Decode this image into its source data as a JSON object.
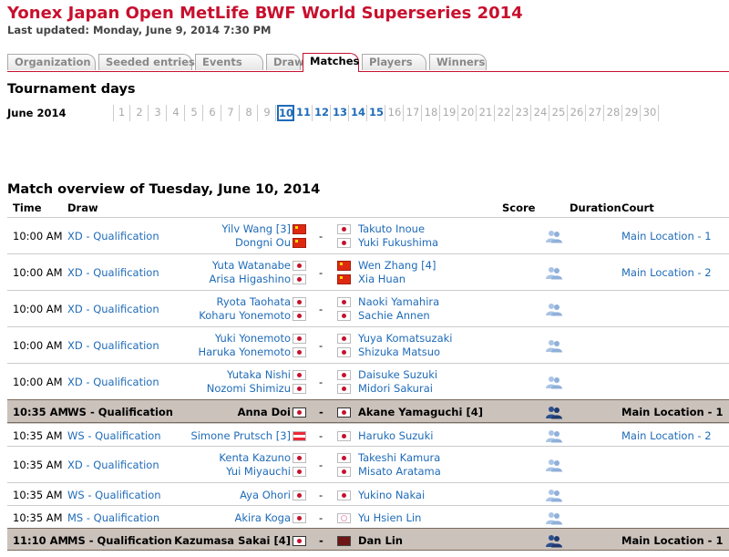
{
  "page": {
    "title": "Yonex Japan Open MetLife BWF World Superseries 2014",
    "last_updated": "Last updated: Monday, June 9, 2014 7:30 PM"
  },
  "tabs": [
    {
      "label": "Organization",
      "active": false
    },
    {
      "label": "Seeded entries",
      "active": false
    },
    {
      "label": "Events",
      "active": false
    },
    {
      "label": "Draws",
      "active": false
    },
    {
      "label": "Matches",
      "active": true
    },
    {
      "label": "Players",
      "active": false
    },
    {
      "label": "Winners",
      "active": false
    }
  ],
  "tournament_days": {
    "heading": "Tournament days",
    "month": "June 2014",
    "days": [
      "1",
      "2",
      "3",
      "4",
      "5",
      "6",
      "7",
      "8",
      "9",
      "10",
      "11",
      "12",
      "13",
      "14",
      "15",
      "16",
      "17",
      "18",
      "19",
      "20",
      "21",
      "22",
      "23",
      "24",
      "25",
      "26",
      "27",
      "28",
      "29",
      "30"
    ],
    "linked_days": [
      "10",
      "11",
      "12",
      "13",
      "14",
      "15"
    ],
    "selected_day": "10"
  },
  "overview": {
    "heading": "Match overview of Tuesday, June 10, 2014",
    "columns": {
      "time": "Time",
      "draw": "Draw",
      "score": "Score",
      "duration": "Duration",
      "court": "Court"
    }
  },
  "colors": {
    "brand": "#c8102e",
    "link": "#1f6bb8",
    "highlight_row": "#cbc2bb"
  },
  "matches": [
    {
      "time": "10:00 AM",
      "draw": "XD - Qualification",
      "left": [
        {
          "name": "Yilv Wang [3]",
          "flag": "cn"
        },
        {
          "name": "Dongni Ou",
          "flag": "cn"
        }
      ],
      "right": [
        {
          "name": "Takuto Inoue",
          "flag": "jp"
        },
        {
          "name": "Yuki Fukushima",
          "flag": "jp"
        }
      ],
      "court": "Main Location - 1",
      "highlight": false
    },
    {
      "time": "10:00 AM",
      "draw": "XD - Qualification",
      "left": [
        {
          "name": "Yuta Watanabe",
          "flag": "jp"
        },
        {
          "name": "Arisa Higashino",
          "flag": "jp"
        }
      ],
      "right": [
        {
          "name": "Wen Zhang [4]",
          "flag": "cn"
        },
        {
          "name": "Xia Huan",
          "flag": "cn"
        }
      ],
      "court": "Main Location - 2",
      "highlight": false
    },
    {
      "time": "10:00 AM",
      "draw": "XD - Qualification",
      "left": [
        {
          "name": "Ryota Taohata",
          "flag": "jp"
        },
        {
          "name": "Koharu Yonemoto",
          "flag": "jp"
        }
      ],
      "right": [
        {
          "name": "Naoki Yamahira",
          "flag": "jp"
        },
        {
          "name": "Sachie Annen",
          "flag": "jp"
        }
      ],
      "court": "",
      "highlight": false
    },
    {
      "time": "10:00 AM",
      "draw": "XD - Qualification",
      "left": [
        {
          "name": "Yuki Yonemoto",
          "flag": "jp"
        },
        {
          "name": "Haruka Yonemoto",
          "flag": "jp"
        }
      ],
      "right": [
        {
          "name": "Yuya Komatsuzaki",
          "flag": "jp"
        },
        {
          "name": "Shizuka Matsuo",
          "flag": "jp"
        }
      ],
      "court": "",
      "highlight": false
    },
    {
      "time": "10:00 AM",
      "draw": "XD - Qualification",
      "left": [
        {
          "name": "Yutaka Nishi",
          "flag": "jp"
        },
        {
          "name": "Nozomi Shimizu",
          "flag": "jp"
        }
      ],
      "right": [
        {
          "name": "Daisuke Suzuki",
          "flag": "jp"
        },
        {
          "name": "Midori Sakurai",
          "flag": "jp"
        }
      ],
      "court": "",
      "highlight": false
    },
    {
      "time": "10:35 AM",
      "draw": "WS - Qualification",
      "left": [
        {
          "name": "Anna Doi",
          "flag": "jp"
        }
      ],
      "right": [
        {
          "name": "Akane Yamaguchi [4]",
          "flag": "jp"
        }
      ],
      "court": "Main Location - 1",
      "highlight": true
    },
    {
      "time": "10:35 AM",
      "draw": "WS - Qualification",
      "left": [
        {
          "name": "Simone Prutsch [3]",
          "flag": "at"
        }
      ],
      "right": [
        {
          "name": "Haruko Suzuki",
          "flag": "jp"
        }
      ],
      "court": "Main Location - 2",
      "highlight": false
    },
    {
      "time": "10:35 AM",
      "draw": "XD - Qualification",
      "left": [
        {
          "name": "Kenta Kazuno",
          "flag": "jp"
        },
        {
          "name": "Yui Miyauchi",
          "flag": "jp"
        }
      ],
      "right": [
        {
          "name": "Takeshi Kamura",
          "flag": "jp"
        },
        {
          "name": "Misato Aratama",
          "flag": "jp"
        }
      ],
      "court": "",
      "highlight": false
    },
    {
      "time": "10:35 AM",
      "draw": "WS - Qualification",
      "left": [
        {
          "name": "Aya Ohori",
          "flag": "jp"
        }
      ],
      "right": [
        {
          "name": "Yukino Nakai",
          "flag": "jp"
        }
      ],
      "court": "",
      "highlight": false
    },
    {
      "time": "10:35 AM",
      "draw": "MS - Qualification",
      "left": [
        {
          "name": "Akira Koga",
          "flag": "jp"
        }
      ],
      "right": [
        {
          "name": "Yu Hsien Lin",
          "flag": "tw"
        }
      ],
      "court": "",
      "highlight": false
    },
    {
      "time": "11:10 AM",
      "draw": "MS - Qualification",
      "left": [
        {
          "name": "Kazumasa Sakai [4]",
          "flag": "jp"
        }
      ],
      "right": [
        {
          "name": "Dan Lin",
          "flag": "cndark"
        }
      ],
      "court": "Main Location - 1",
      "highlight": true
    }
  ],
  "dash": "-",
  "h2h_icon": "head-to-head-icon"
}
